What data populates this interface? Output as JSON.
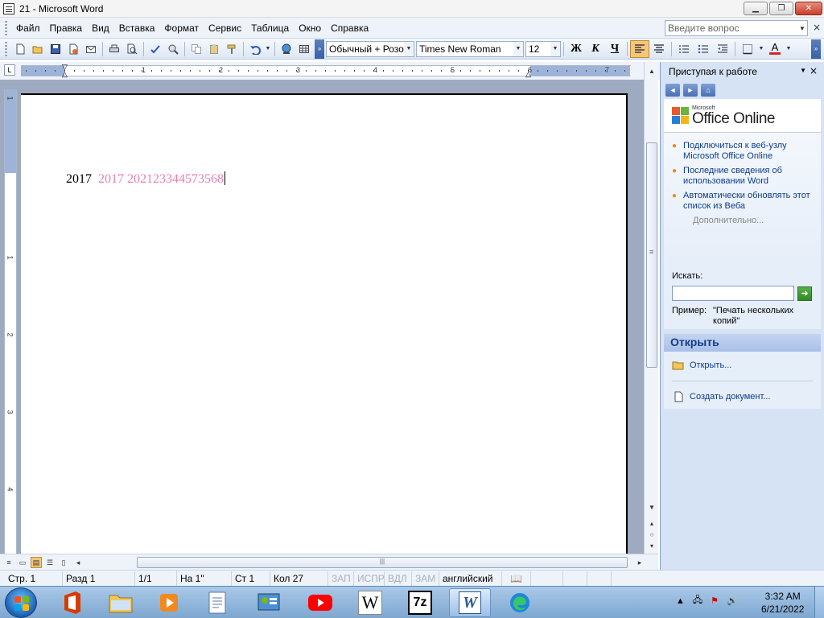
{
  "window": {
    "title": "21 - Microsoft Word",
    "min_glyph": "▁",
    "max_glyph": "❐",
    "close_glyph": "✕"
  },
  "menu": {
    "items": [
      "Файл",
      "Правка",
      "Вид",
      "Вставка",
      "Формат",
      "Сервис",
      "Таблица",
      "Окно",
      "Справка"
    ],
    "ask_placeholder": "Введите вопрос",
    "close_glyph": "×"
  },
  "toolbar": {
    "style": "Обычный + Розо",
    "font": "Times New Roman",
    "size": "12",
    "bold": "Ж",
    "italic": "К",
    "underline": "Ч",
    "font_color_letter": "А"
  },
  "ruler": {
    "corner": "L",
    "numbers": [
      "1",
      "2",
      "3",
      "4",
      "5",
      "6",
      "7"
    ],
    "vertical_numbers": [
      "1",
      "1",
      "2",
      "3",
      "4"
    ]
  },
  "document": {
    "text_normal": "2017",
    "text_inserted": "2017 202123344573568"
  },
  "task_pane": {
    "title": "Приступая к работе",
    "logo_small": "Microsoft",
    "logo_big": "Office Online",
    "links": [
      "Подключиться к веб-узлу Microsoft Office Online",
      "Последние сведения об использовании Word",
      "Автоматически обновлять этот список из Веба"
    ],
    "more": "Дополнительно...",
    "search_label": "Искать:",
    "example_label": "Пример:",
    "example_text": "\"Печать нескольких копий\"",
    "open_section": "Открыть",
    "open_link": "Открыть...",
    "create_link": "Создать документ..."
  },
  "status": {
    "page": "Стр. 1",
    "section": "Разд 1",
    "pages": "1/1",
    "at": "На 1\"",
    "line": "Ст 1",
    "col": "Кол 27",
    "rec": "ЗАП",
    "trk": "ИСПР",
    "ext": "ВДЛ",
    "ovr": "ЗАМ",
    "lang": "английский"
  },
  "taskbar": {
    "time": "3:32 AM",
    "date": "6/21/2022",
    "apps": [
      "office",
      "explorer",
      "media-player",
      "text-document",
      "control-panel",
      "youtube",
      "wikipedia",
      "7zip",
      "word",
      "edge"
    ],
    "wiki_letter": "W",
    "sevenzip_label": "7z",
    "word_letter": "W"
  },
  "colors": {
    "inserted_text": "#e87fb3",
    "accent": "#143c88",
    "link": "#0c3c8c"
  }
}
